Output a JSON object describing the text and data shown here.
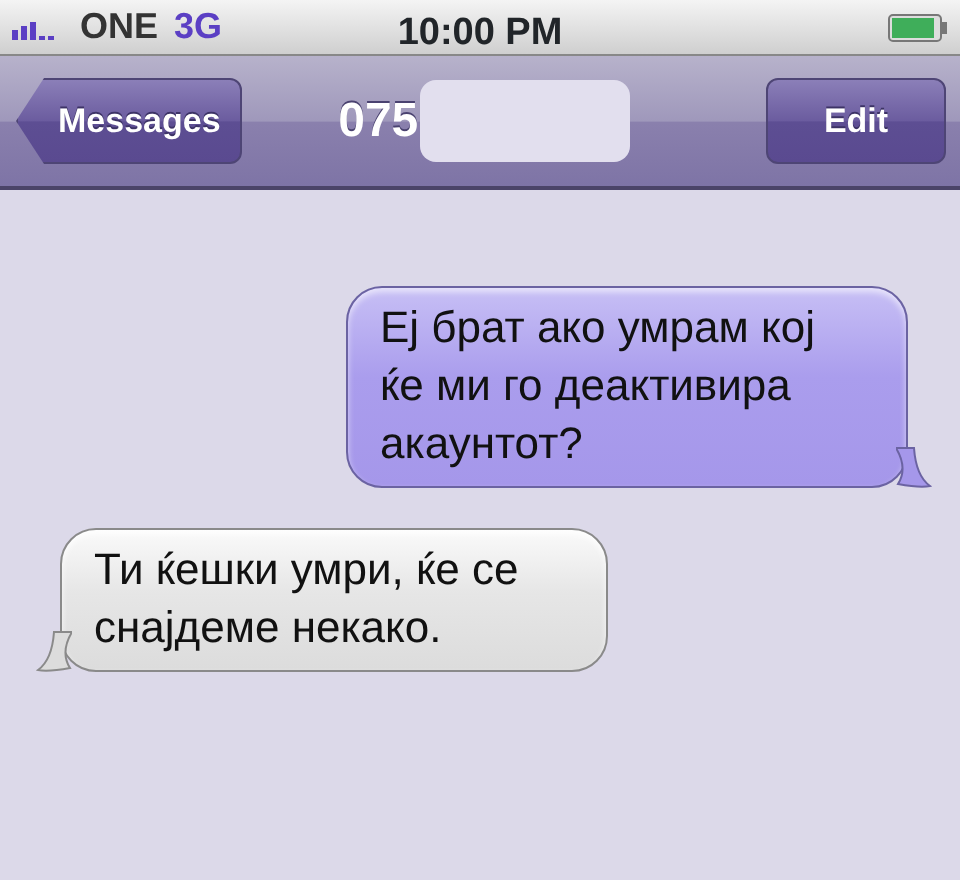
{
  "status_bar": {
    "carrier": "ONE",
    "network": "3G",
    "time": "10:00 PM"
  },
  "nav_bar": {
    "back_button": "Messages",
    "title": "075",
    "edit_button": "Edit"
  },
  "messages": [
    {
      "kind": "sent",
      "text": "Ej брат ако умрам кој ќе ми го деактивира акаунтот?"
    },
    {
      "kind": "received",
      "text": "Ти ќешки умри, ќе се снајдеме некако."
    }
  ]
}
